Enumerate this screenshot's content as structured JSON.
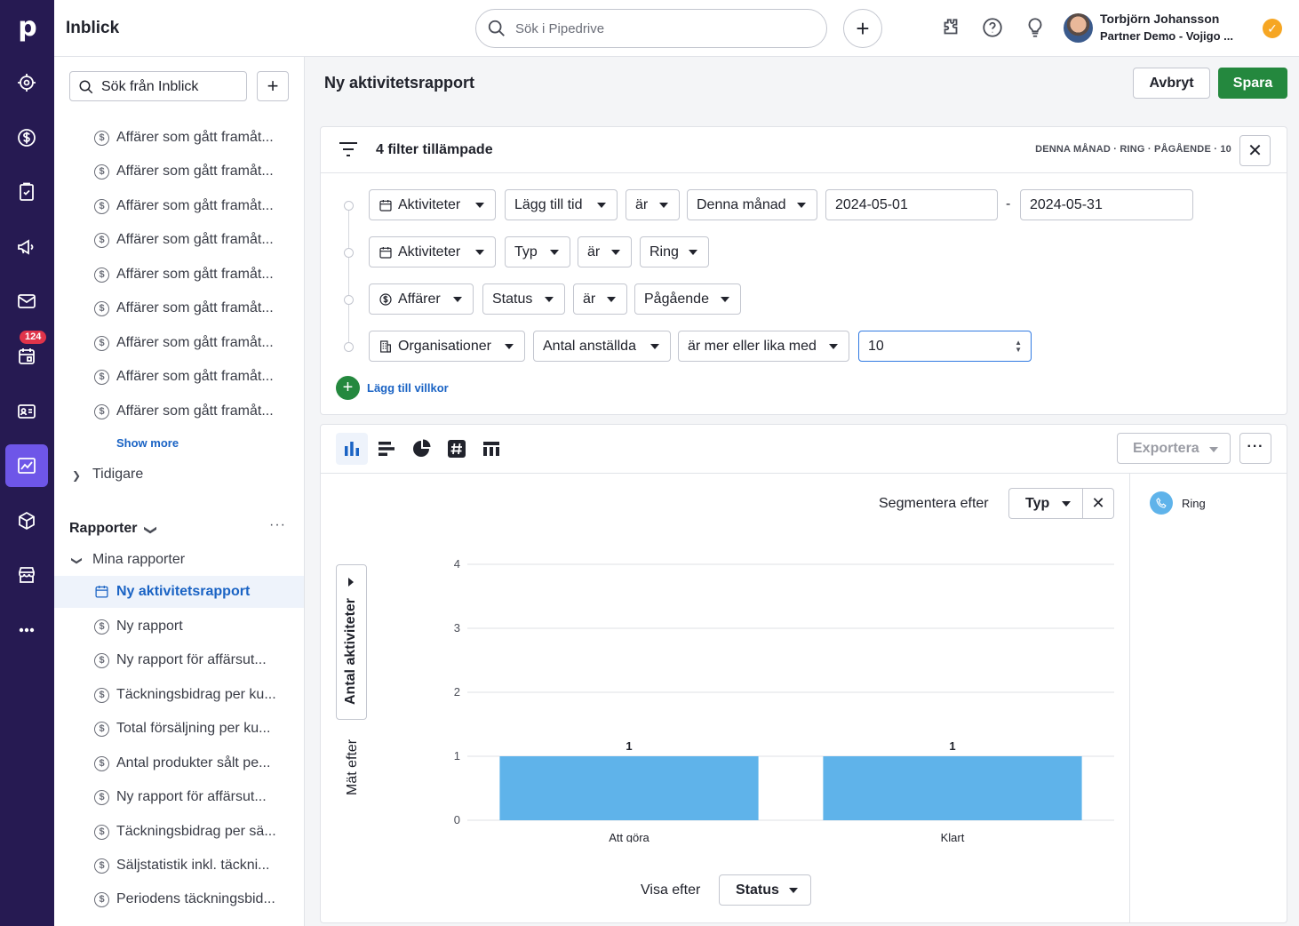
{
  "app": {
    "logo": "p",
    "title": "Inblick"
  },
  "topbar": {
    "search_placeholder": "Sök i Pipedrive",
    "user_name": "Torbjörn Johansson",
    "user_company": "Partner Demo - Vojigo ..."
  },
  "rail": {
    "badge": "124",
    "icons": [
      "focus-icon",
      "deals-icon",
      "tasks-icon",
      "campaigns-icon",
      "mail-icon",
      "calendar-icon",
      "contacts-icon",
      "insights-icon",
      "products-icon",
      "marketplace-icon",
      "more-icon"
    ]
  },
  "sidebar": {
    "search_placeholder": "Sök från Inblick",
    "recent_items": [
      "Affärer som gått framåt...",
      "Affärer som gått framåt...",
      "Affärer som gått framåt...",
      "Affärer som gått framåt...",
      "Affärer som gått framåt...",
      "Affärer som gått framåt...",
      "Affärer som gått framåt...",
      "Affärer som gått framåt...",
      "Affärer som gått framåt..."
    ],
    "show_more": "Show more",
    "earlier": "Tidigare",
    "reports_heading": "Rapporter",
    "my_reports": "Mina rapporter",
    "reports": [
      "Ny aktivitetsrapport",
      "Ny rapport",
      "Ny rapport för affärsut...",
      "Täckningsbidrag per ku...",
      "Total försäljning per ku...",
      "Antal produkter sålt pe...",
      "Ny rapport för affärsut...",
      "Täckningsbidrag per sä...",
      "Säljstatistik inkl. täckni...",
      "Periodens täckningsbid..."
    ]
  },
  "main": {
    "title": "Ny aktivitetsrapport",
    "cancel": "Avbryt",
    "save": "Spara",
    "filters": {
      "count_label": "4 filter tillämpade",
      "summary": "DENNA MÅNAD  ·  RING  ·  PÅGÅENDE  ·  10",
      "rows": [
        {
          "entity": "Aktiviteter",
          "field": "Lägg till tid",
          "op": "är",
          "value": "Denna månad",
          "from": "2024-05-01",
          "sep": "-",
          "to": "2024-05-31"
        },
        {
          "entity": "Aktiviteter",
          "field": "Typ",
          "op": "är",
          "value": "Ring"
        },
        {
          "entity": "Affärer",
          "field": "Status",
          "op": "är",
          "value": "Pågående"
        },
        {
          "entity": "Organisationer",
          "field": "Antal anställda",
          "op": "är mer eller lika med",
          "value": "10"
        }
      ],
      "add_condition": "Lägg till villkor"
    },
    "chart": {
      "export": "Exportera",
      "more": "···",
      "segment_label": "Segmentera efter",
      "segment_value": "Typ",
      "y_measure": "Antal aktiviteter",
      "measure_label": "Mät efter",
      "view_label": "Visa efter",
      "view_value": "Status",
      "legend": "Ring"
    }
  },
  "chart_data": {
    "type": "bar",
    "categories": [
      "Att göra",
      "Klart"
    ],
    "series": [
      {
        "name": "Ring",
        "values": [
          1,
          1
        ]
      }
    ],
    "yticks": [
      "0",
      "1",
      "2",
      "3",
      "4"
    ],
    "ylim": [
      0,
      4
    ],
    "bar_color": "#5fb3ea",
    "grid": true
  }
}
